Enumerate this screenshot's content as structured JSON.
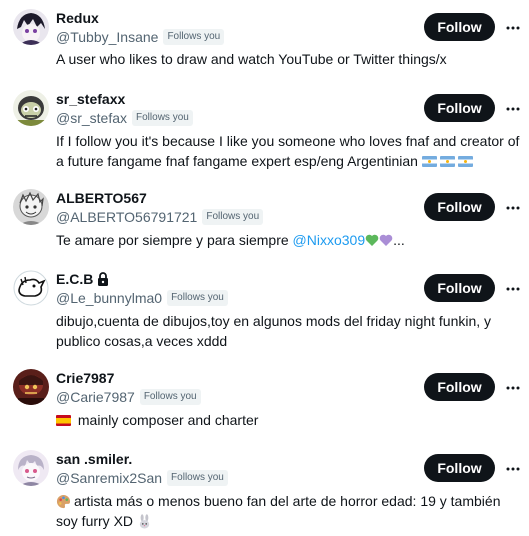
{
  "follow_label": "Follows you",
  "button_label": "Follow",
  "users": [
    {
      "name": "Redux",
      "handle": "@Tubby_Insane",
      "bio_lines": [
        "A user who likes to draw and watch YouTube or Twitter things/x"
      ]
    },
    {
      "name": "sr_stefaxx",
      "handle": "@sr_stefax",
      "bio_lines": [
        "If I follow you it's because I like you someone who loves fnaf and creator of",
        "a future fangame fnaf fangame expert esp/eng Argentinian"
      ],
      "bio_emojis": [
        "argentina-flag",
        "argentina-flag",
        "argentina-flag"
      ]
    },
    {
      "name": "ALBERTO567",
      "handle": "@ALBERTO56791721",
      "bio_prefix": "Te amare por siempre y para siempre ",
      "bio_mention": "@Nixxo309",
      "bio_suffix": "...",
      "bio_emojis": [
        "green-heart",
        "purple-heart"
      ]
    },
    {
      "name": "E.C.B",
      "handle": "@Le_bunnylma0",
      "protected": true,
      "bio_lines": [
        "dibujo,cuenta de dibujos,toy en algunos mods del friday night funkin, y",
        "publico cosas,a veces xddd"
      ]
    },
    {
      "name": "Crie7987",
      "handle": "@Carie7987",
      "bio_lines": [
        "mainly composer and charter"
      ],
      "bio_emojis": [
        "spain-flag"
      ]
    },
    {
      "name": "san .smiler.",
      "handle": "@Sanremix2San",
      "bio_lines": [
        "artista más o menos bueno fan del arte de horror edad: 19 y también",
        "soy furry XD"
      ],
      "bio_emojis": [
        "palette",
        "rabbit"
      ]
    }
  ],
  "colors": {
    "text": "#0f1419",
    "secondary": "#536471",
    "link": "#1d9bf0",
    "button_bg": "#0f1419",
    "badge_bg": "#eff3f4"
  }
}
